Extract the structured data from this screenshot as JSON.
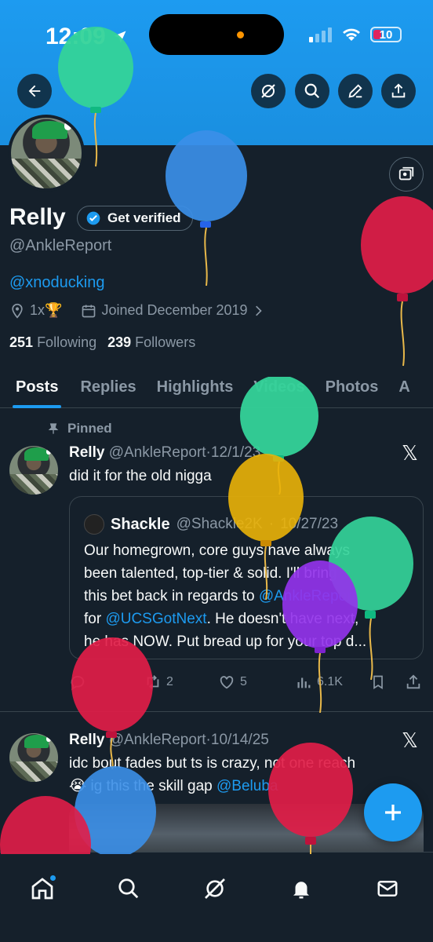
{
  "status_bar": {
    "time": "12:09",
    "battery": "10"
  },
  "colors": {
    "background": "#15202b",
    "banner": "#1d9bf0",
    "accent": "#1d9bf0",
    "muted": "#8b98a5",
    "border": "#38444d"
  },
  "header_icons": [
    "back-arrow-icon",
    "grok-icon",
    "search-icon",
    "edit-icon",
    "share-icon"
  ],
  "profile": {
    "name": "Relly",
    "verify_label": "Get verified",
    "handle": "@AnkleReport",
    "bio_link": "@xnoducking",
    "location": "1x🏆",
    "joined": "Joined December 2019",
    "following_count": "251",
    "following_label": "Following",
    "followers_count": "239",
    "followers_label": "Followers"
  },
  "tabs": [
    {
      "label": "Posts",
      "active": true
    },
    {
      "label": "Replies"
    },
    {
      "label": "Highlights"
    },
    {
      "label": "Videos"
    },
    {
      "label": "Photos"
    },
    {
      "label": "A"
    }
  ],
  "posts": [
    {
      "pinned_label": "Pinned",
      "author": "Relly",
      "handle": "@AnkleReport",
      "sep": "·",
      "date": "12/1/23",
      "text": "did it for the old nigga",
      "quote": {
        "author": "Shackle",
        "handle": "@Shackle2K",
        "sep": "·",
        "date": "10/27/23",
        "lines": [
          "Our homegrown, core guys have always",
          "been talented, top-tier & solid. I'll bring",
          "this bet back in regards to ",
          "@AnkleReport",
          "for ",
          "@UCSGotNext",
          ". He doesn't have next,",
          "he has NOW. Put bread up for your top d..."
        ]
      },
      "actions": {
        "reposts": "2",
        "likes": "5",
        "views": "6.1K"
      }
    },
    {
      "author": "Relly",
      "handle": "@AnkleReport",
      "sep": "·",
      "date": "10/14/25",
      "text_line1": "idc bout fades but ts is crazy, not one reach",
      "text_line2_pre": "😭 ig this the skill gap ",
      "text_line2_link": "@Beluba"
    }
  ],
  "fab_icon": "plus-icon",
  "nav": [
    "home-icon",
    "search-icon",
    "grok-icon",
    "notifications-icon",
    "messages-icon"
  ]
}
